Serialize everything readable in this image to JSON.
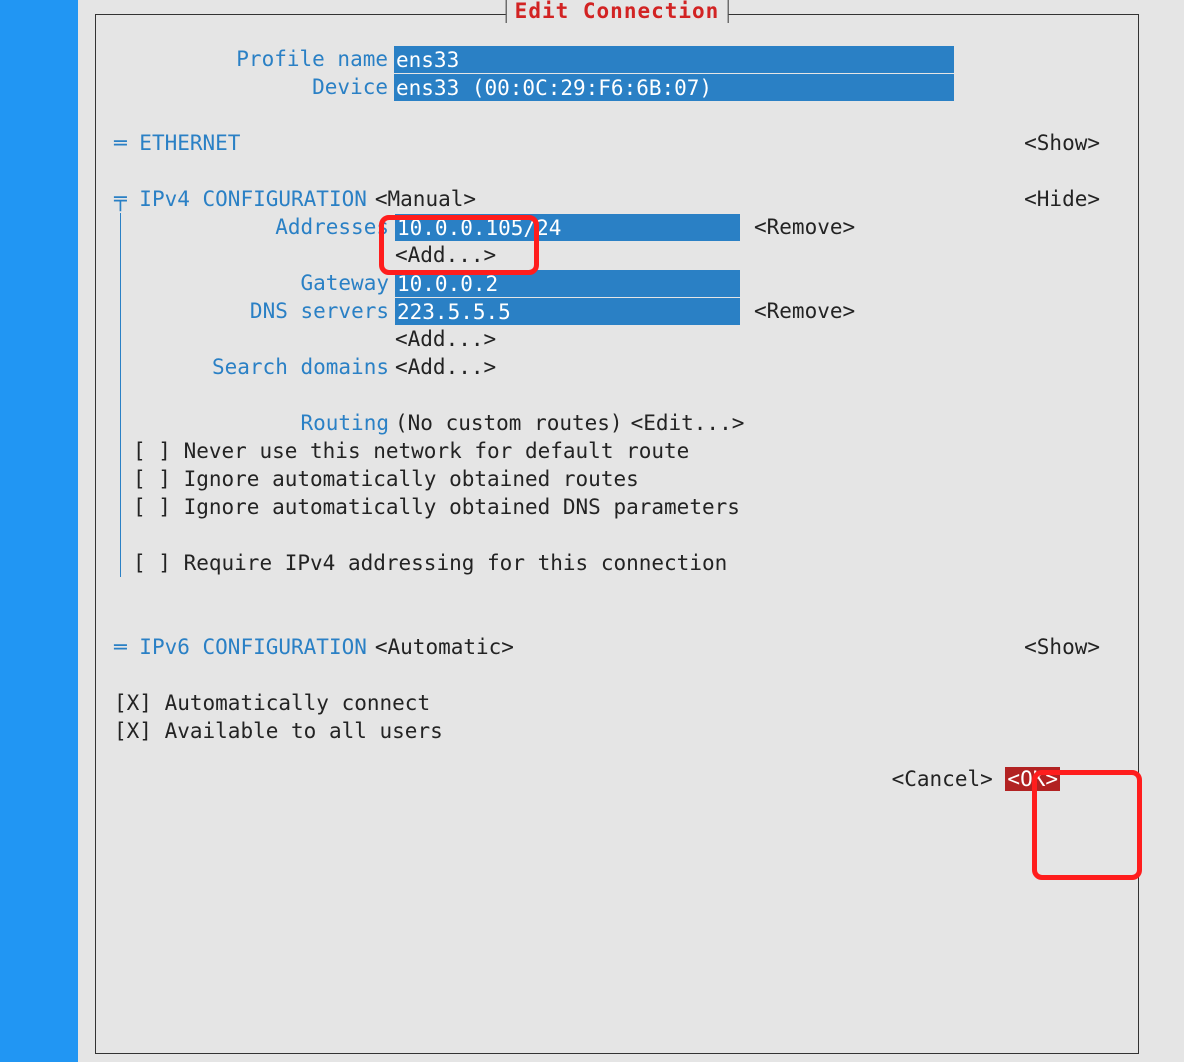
{
  "title": "Edit Connection",
  "profile": {
    "label": "Profile name",
    "value": "ens33"
  },
  "device": {
    "label": "Device",
    "value": "ens33 (00:0C:29:F6:6B:07)"
  },
  "ethernet": {
    "heading": "ETHERNET",
    "toggle": "<Show>"
  },
  "ipv4": {
    "heading": "IPv4 CONFIGURATION",
    "mode": "<Manual>",
    "toggle": "<Hide>",
    "addresses": {
      "label": "Addresses",
      "value": "10.0.0.105/24",
      "remove": "<Remove>",
      "add": "<Add...>"
    },
    "gateway": {
      "label": "Gateway",
      "value": "10.0.0.2"
    },
    "dns": {
      "label": "DNS servers",
      "value": "223.5.5.5",
      "remove": "<Remove>",
      "add": "<Add...>"
    },
    "search": {
      "label": "Search domains",
      "add": "<Add...>"
    },
    "routing": {
      "label": "Routing",
      "status": "(No custom routes)",
      "edit": "<Edit...>"
    },
    "checks": {
      "never_default": {
        "state": "[ ]",
        "label": "Never use this network for default route"
      },
      "ignore_routes": {
        "state": "[ ]",
        "label": "Ignore automatically obtained routes"
      },
      "ignore_dns": {
        "state": "[ ]",
        "label": "Ignore automatically obtained DNS parameters"
      },
      "require_ipv4": {
        "state": "[ ]",
        "label": "Require IPv4 addressing for this connection"
      }
    }
  },
  "ipv6": {
    "heading": "IPv6 CONFIGURATION",
    "mode": "<Automatic>",
    "toggle": "<Show>"
  },
  "global": {
    "autoconnect": {
      "state": "[X]",
      "label": "Automatically connect"
    },
    "allusers": {
      "state": "[X]",
      "label": "Available to all users"
    }
  },
  "buttons": {
    "cancel": "<Cancel>",
    "ok": "<OK>"
  }
}
